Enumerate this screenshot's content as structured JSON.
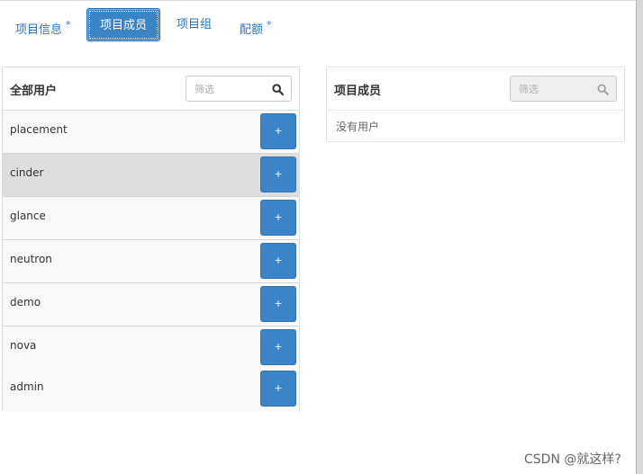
{
  "tabs": [
    {
      "label": "项目信息",
      "required": "*"
    },
    {
      "label": "项目成员"
    },
    {
      "label": "项目组"
    },
    {
      "label": "配额",
      "required": "*"
    }
  ],
  "all_users": {
    "title": "全部用户",
    "filter_placeholder": "筛选",
    "add_label": "+",
    "users": [
      {
        "name": "placement"
      },
      {
        "name": "cinder"
      },
      {
        "name": "glance"
      },
      {
        "name": "neutron"
      },
      {
        "name": "demo"
      },
      {
        "name": "nova"
      },
      {
        "name": "admin"
      }
    ]
  },
  "project_members": {
    "title": "项目成员",
    "filter_placeholder": "筛选",
    "empty_text": "没有用户"
  },
  "watermark": "CSDN @就这样?",
  "colors": {
    "accent": "#3b84c8",
    "link": "#2e75b5",
    "selected_row": "#dedede"
  }
}
